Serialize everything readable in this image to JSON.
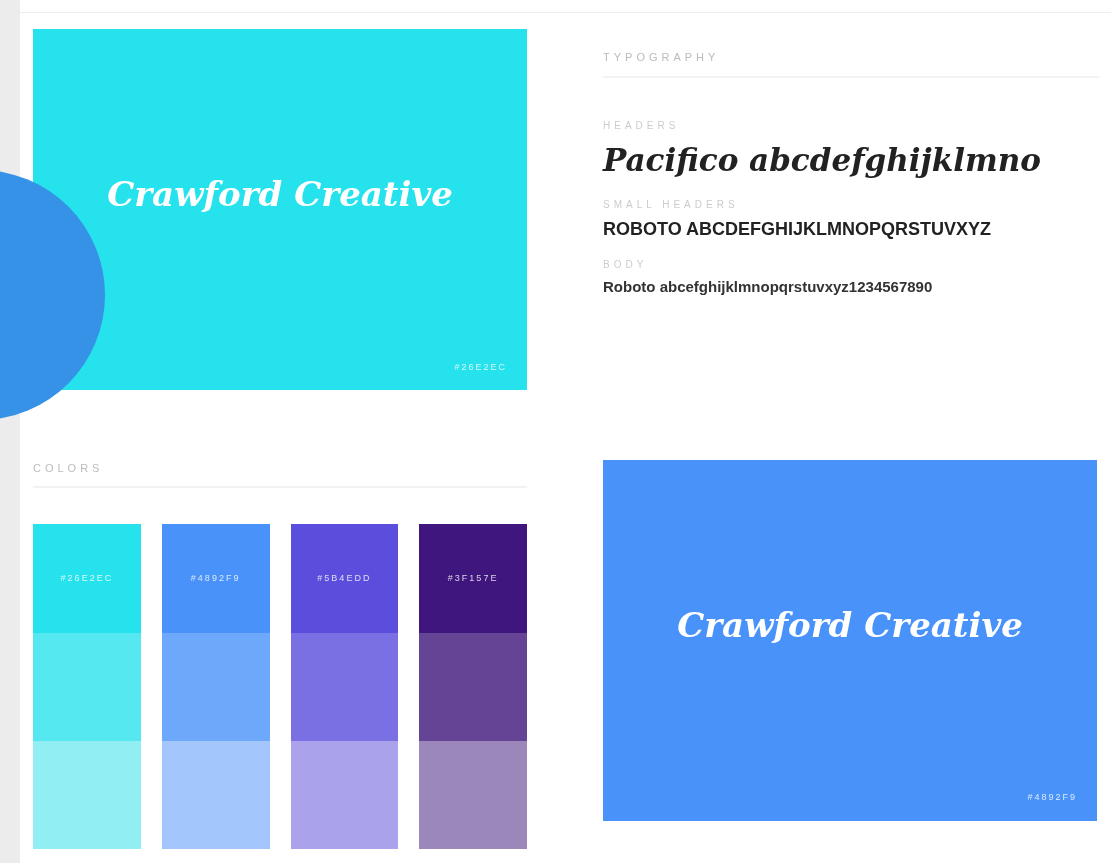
{
  "brand_banner": {
    "title": "Crawford Creative",
    "hex": "#26E2EC",
    "color": "#26e2ec"
  },
  "typography": {
    "heading": "TYPOGRAPHY",
    "samples": [
      {
        "label": "HEADERS",
        "kind": "script",
        "text": "Pacifico abcdefghijklmno"
      },
      {
        "label": "SMALL HEADERS",
        "kind": "caps",
        "text": "ROBOTO ABCDEFGHIJKLMNOPQRSTUVXYZ"
      },
      {
        "label": "BODY",
        "kind": "body",
        "text": "Roboto abcefghijklmnopqrstuvxyz1234567890"
      }
    ]
  },
  "colors": {
    "heading": "COLORS",
    "swatches": [
      {
        "hex": "#26E2EC",
        "color": "#26e2ec",
        "tints": [
          {
            "color": "#55e8f0"
          },
          {
            "color": "#91eff4"
          }
        ]
      },
      {
        "hex": "#4892F9",
        "color": "#4892f9",
        "tints": [
          {
            "color": "#6ea8fa"
          },
          {
            "color": "#a3c7fc"
          }
        ]
      },
      {
        "hex": "#5B4EDD",
        "color": "#5b4edd",
        "tints": [
          {
            "color": "#7b70e3"
          },
          {
            "color": "#aaa3ec"
          }
        ]
      },
      {
        "hex": "#3F157E",
        "color": "#3f157e",
        "tints": [
          {
            "color": "#654496"
          },
          {
            "color": "#9c87bb"
          }
        ]
      }
    ]
  },
  "second_banner": {
    "title": "Crawford Creative",
    "hex": "#4892F9",
    "color": "#4892f9"
  }
}
